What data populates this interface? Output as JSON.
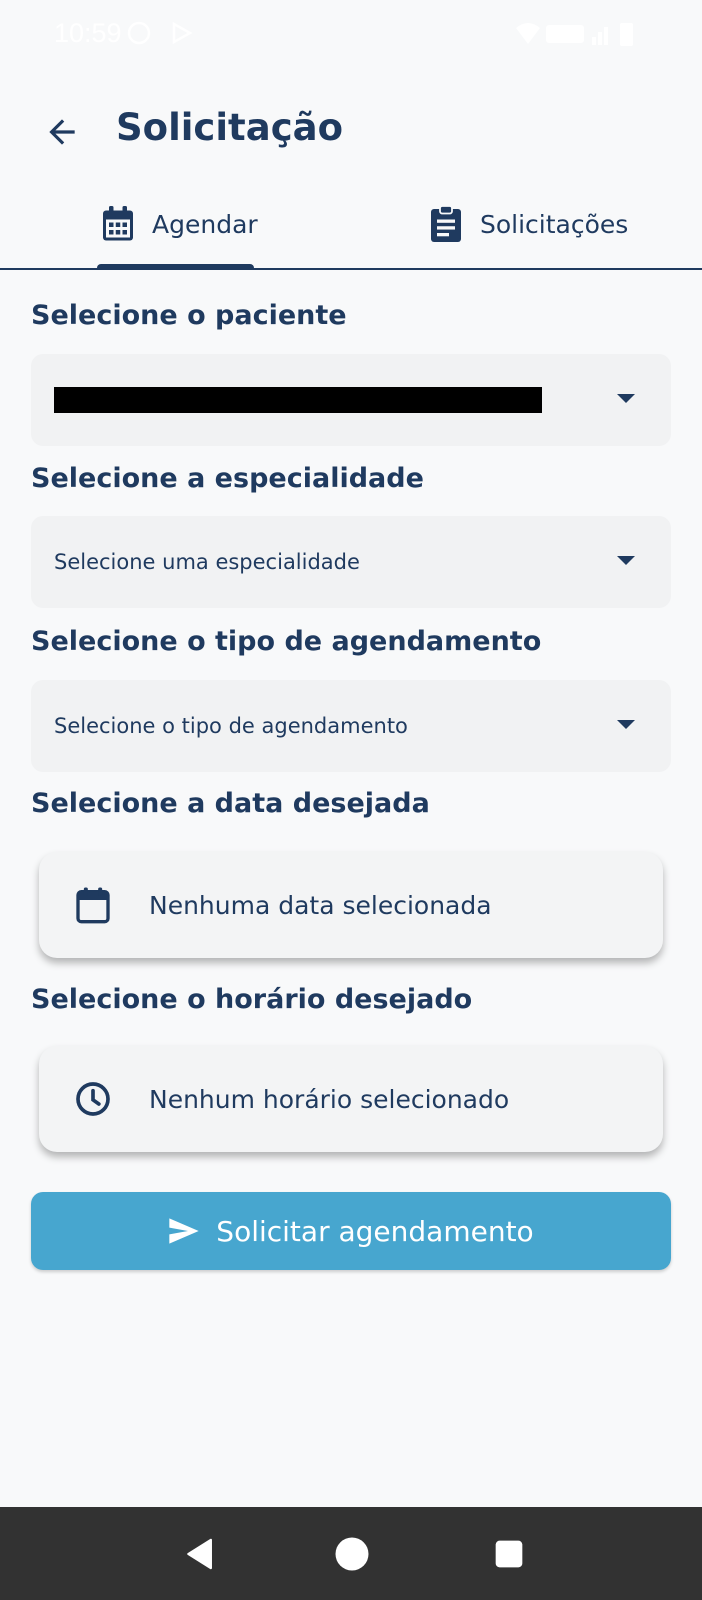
{
  "status_bar": {
    "time": "10:59",
    "icons_left": [
      "whatsapp-icon",
      "play-icon"
    ],
    "icons_right": [
      "wifi-icon",
      "lte-icon",
      "signal-icon",
      "battery-icon"
    ]
  },
  "app_bar": {
    "title": "Solicitação",
    "back_icon": "arrow-left-icon"
  },
  "tabs": [
    {
      "label": "Agendar",
      "icon": "calendar-icon",
      "selected": true
    },
    {
      "label": "Solicitações",
      "icon": "clipboard-icon",
      "selected": false
    }
  ],
  "form": {
    "patient": {
      "label": "Selecione o paciente",
      "value_redacted": true
    },
    "specialty": {
      "label": "Selecione a especialidade",
      "placeholder": "Selecione uma especialidade"
    },
    "schedule_type": {
      "label": "Selecione o tipo de agendamento",
      "placeholder": "Selecione o tipo de agendamento"
    },
    "date": {
      "label": "Selecione a data desejada",
      "value": "Nenhuma data selecionada",
      "icon": "calendar-icon"
    },
    "time": {
      "label": "Selecione o horário desejado",
      "value": "Nenhum horário selecionado",
      "icon": "clock-icon"
    },
    "submit": {
      "label": "Solicitar agendamento",
      "icon": "send-icon"
    }
  },
  "colors": {
    "primary": "#1f3a5f",
    "button": "#47a6cf",
    "background": "#f8f9fa",
    "field": "#f1f2f3",
    "nav_bar": "#323232"
  },
  "nav_bar": [
    "back-triangle-icon",
    "home-circle-icon",
    "recents-square-icon"
  ]
}
